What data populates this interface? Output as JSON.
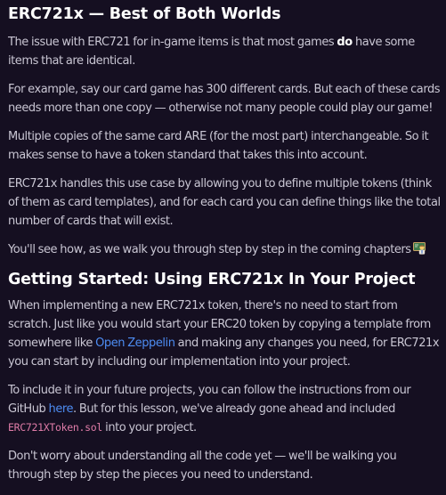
{
  "section1": {
    "title": "ERC721x — Best of Both Worlds",
    "p1": {
      "before": "The issue with ERC721 for in-game items is that most games ",
      "bold": "do",
      "after": " have some items that are identical."
    },
    "p2": "For example, say our card game has 300 different cards. But each of these cards needs more than one copy — otherwise not many people could play our game!",
    "p3": "Multiple copies of the same card ARE (for the most part) interchangeable. So it makes sense to have a token standard that takes this into account.",
    "p4": "ERC721x handles this use case by allowing you to define multiple tokens (think of them as card templates), and for each card you can define things like the total number of cards that will exist.",
    "p5": {
      "text": "You'll see how, as we walk you through step by step in the coming chapters",
      "emoji_icon": "teacher-emoji-icon"
    }
  },
  "section2": {
    "title": "Getting Started: Using ERC721x In Your Project",
    "p1": {
      "before": "When implementing a new ERC721x token, there's no need to start from scratch. Just like you would start your ERC20 token by copying a template from somewhere like ",
      "link": "Open Zeppelin",
      "after": " and making any changes you need, for ERC721x you can start by including our implementation into your project."
    },
    "p2": {
      "before": "To include it in your future projects, you can follow the instructions from our GitHub ",
      "link": "here",
      "middle": ". But for this lesson, we've already gone ahead and included ",
      "code": "ERC721XToken.sol",
      "after": " into your project."
    },
    "p3": "Don't worry about understanding all the code yet — we'll be walking you through step by step the pieces you need to understand."
  },
  "colors": {
    "background": "#150f21",
    "text": "#c9c6d3",
    "heading": "#ffffff",
    "link": "#4d8cf2",
    "code": "#e07ca8"
  }
}
